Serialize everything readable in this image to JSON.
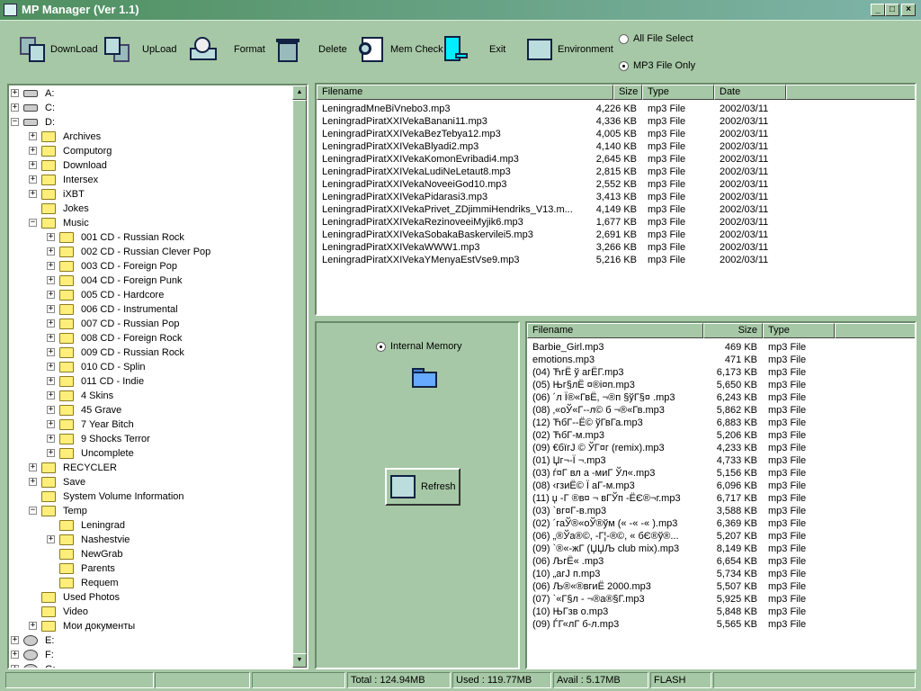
{
  "window": {
    "title": "MP Manager (Ver 1.1)",
    "minimize": "_",
    "maximize": "□",
    "close": "×"
  },
  "toolbar": {
    "buttons": [
      {
        "label": "DownLoad",
        "icon": "download-icon"
      },
      {
        "label": "UpLoad",
        "icon": "upload-icon"
      },
      {
        "label": "Format",
        "icon": "format-disk-icon"
      },
      {
        "label": "Delete",
        "icon": "trash-icon"
      },
      {
        "label": "Mem Check",
        "icon": "mem-check-icon"
      },
      {
        "label": "Exit",
        "icon": "exit-door-icon"
      },
      {
        "label": "Environment",
        "icon": "environment-icon"
      }
    ],
    "filter_all": "All File Select",
    "filter_mp3": "MP3 File Only",
    "selected_filter": "mp3"
  },
  "tree": [
    {
      "label": "A:",
      "level": 0,
      "exp": "+",
      "icon": "floppy"
    },
    {
      "label": "C:",
      "level": 0,
      "exp": "+",
      "icon": "drive"
    },
    {
      "label": "D:",
      "level": 0,
      "exp": "-",
      "icon": "drive"
    },
    {
      "label": "Archives",
      "level": 1,
      "exp": "+"
    },
    {
      "label": "Computorg",
      "level": 1,
      "exp": "+"
    },
    {
      "label": "Download",
      "level": 1,
      "exp": "+"
    },
    {
      "label": "Intersex",
      "level": 1,
      "exp": "+"
    },
    {
      "label": "iXBT",
      "level": 1,
      "exp": "+"
    },
    {
      "label": "Jokes",
      "level": 1,
      "exp": ""
    },
    {
      "label": "Music",
      "level": 1,
      "exp": "-"
    },
    {
      "label": "001 CD - Russian Rock",
      "level": 2,
      "exp": "+"
    },
    {
      "label": "002 CD - Russian Clever Pop",
      "level": 2,
      "exp": "+"
    },
    {
      "label": "003 CD - Foreign Pop",
      "level": 2,
      "exp": "+"
    },
    {
      "label": "004 CD - Foreign Punk",
      "level": 2,
      "exp": "+"
    },
    {
      "label": "005 CD - Hardcore",
      "level": 2,
      "exp": "+"
    },
    {
      "label": "006 CD - Instrumental",
      "level": 2,
      "exp": "+"
    },
    {
      "label": "007 CD - Russian Pop",
      "level": 2,
      "exp": "+"
    },
    {
      "label": "008 CD - Foreign Rock",
      "level": 2,
      "exp": "+"
    },
    {
      "label": "009 CD - Russian Rock",
      "level": 2,
      "exp": "+"
    },
    {
      "label": "010 CD - Splin",
      "level": 2,
      "exp": "+"
    },
    {
      "label": "011 CD - Indie",
      "level": 2,
      "exp": "+"
    },
    {
      "label": "4 Skins",
      "level": 2,
      "exp": "+"
    },
    {
      "label": "45 Grave",
      "level": 2,
      "exp": "+"
    },
    {
      "label": "7 Year Bitch",
      "level": 2,
      "exp": "+"
    },
    {
      "label": "9 Shocks Terror",
      "level": 2,
      "exp": "+"
    },
    {
      "label": "Uncomplete",
      "level": 2,
      "exp": "+"
    },
    {
      "label": "RECYCLER",
      "level": 1,
      "exp": "+"
    },
    {
      "label": "Save",
      "level": 1,
      "exp": "+"
    },
    {
      "label": "System Volume Information",
      "level": 1,
      "exp": ""
    },
    {
      "label": "Temp",
      "level": 1,
      "exp": "-"
    },
    {
      "label": "Leningrad",
      "level": 2,
      "exp": "",
      "icon": "folder-open"
    },
    {
      "label": "Nashestvie",
      "level": 2,
      "exp": "+"
    },
    {
      "label": "NewGrab",
      "level": 2,
      "exp": ""
    },
    {
      "label": "Parents",
      "level": 2,
      "exp": ""
    },
    {
      "label": "Requem",
      "level": 2,
      "exp": ""
    },
    {
      "label": "Used Photos",
      "level": 1,
      "exp": ""
    },
    {
      "label": "Video",
      "level": 1,
      "exp": ""
    },
    {
      "label": "Мои документы",
      "level": 1,
      "exp": "+"
    },
    {
      "label": "E:",
      "level": 0,
      "exp": "+",
      "icon": "cd"
    },
    {
      "label": "F:",
      "level": 0,
      "exp": "+",
      "icon": "cd"
    },
    {
      "label": "G:",
      "level": 0,
      "exp": "+",
      "icon": "cd"
    }
  ],
  "pc_list": {
    "headers": [
      "Filename",
      "Size",
      "Type",
      "Date"
    ],
    "rows": [
      [
        "LeningradMneBiVnebo3.mp3",
        "4,226 KB",
        "mp3 File",
        "2002/03/11"
      ],
      [
        "LeningradPiratXXIVekaBanani11.mp3",
        "4,336 KB",
        "mp3 File",
        "2002/03/11"
      ],
      [
        "LeningradPiratXXIVekaBezTebya12.mp3",
        "4,005 KB",
        "mp3 File",
        "2002/03/11"
      ],
      [
        "LeningradPiratXXIVekaBlyadi2.mp3",
        "4,140 KB",
        "mp3 File",
        "2002/03/11"
      ],
      [
        "LeningradPiratXXIVekaKomonEvribadi4.mp3",
        "2,645 KB",
        "mp3 File",
        "2002/03/11"
      ],
      [
        "LeningradPiratXXIVekaLudiNeLetaut8.mp3",
        "2,815 KB",
        "mp3 File",
        "2002/03/11"
      ],
      [
        "LeningradPiratXXIVekaNoveeiGod10.mp3",
        "2,552 KB",
        "mp3 File",
        "2002/03/11"
      ],
      [
        "LeningradPiratXXIVekaPidarasi3.mp3",
        "3,413 KB",
        "mp3 File",
        "2002/03/11"
      ],
      [
        "LeningradPiratXXIVekaPrivet_ZDjimmiHendriks_V13.m...",
        "4,149 KB",
        "mp3 File",
        "2002/03/11"
      ],
      [
        "LeningradPiratXXIVekaRezinoveeiMyjik6.mp3",
        "1,677 KB",
        "mp3 File",
        "2002/03/11"
      ],
      [
        "LeningradPiratXXIVekaSobakaBaskervilei5.mp3",
        "2,691 KB",
        "mp3 File",
        "2002/03/11"
      ],
      [
        "LeningradPiratXXIVekaWWW1.mp3",
        "3,266 KB",
        "mp3 File",
        "2002/03/11"
      ],
      [
        "LeningradPiratXXIVekaYMenyaEstVse9.mp3",
        "5,216 KB",
        "mp3 File",
        "2002/03/11"
      ]
    ]
  },
  "device": {
    "memory_label": "Internal Memory",
    "refresh": "Refresh"
  },
  "device_list": {
    "headers": [
      "Filename",
      "Size",
      "Type"
    ],
    "rows": [
      [
        "Barbie_Girl.mp3",
        "469 KB",
        "mp3 File"
      ],
      [
        "emotions.mp3",
        "471 KB",
        "mp3 File"
      ],
      [
        "(04) ЋгЁ  ў агЁГ.mp3",
        "6,173 KB",
        "mp3 File"
      ],
      [
        "(05) Њг§лЁ  ¤®і¤п.mp3",
        "5,650 KB",
        "mp3 File"
      ],
      [
        "(06) ´л Ї®«ГвЁ, ¬®п §ўГ§¤ .mp3",
        "6,243 KB",
        "mp3 File"
      ],
      [
        "(08) ‚«оЎ«Г--л© б ¬®«Гв.mp3",
        "5,862 KB",
        "mp3 File"
      ],
      [
        "(12) ЋбГ--Ё© ўГвГа.mp3",
        "6,883 KB",
        "mp3 File"
      ],
      [
        "(02) ЋбГ-м.mp3",
        "5,206 KB",
        "mp3 File"
      ],
      [
        "(09) €бїгЈ © ЎГ¤г (remix).mp3",
        "4,233 KB",
        "mp3 File"
      ],
      [
        "(01) Џг¬-Ї ¬.mp3",
        "4,733 KB",
        "mp3 File"
      ],
      [
        "(03) ѓ¤Г вл а -миГ Ўл«.mp3",
        "5,156 KB",
        "mp3 File"
      ],
      [
        "(08) ‹гзиЁ© Ї аГ-м.mp3",
        "6,096 KB",
        "mp3 File"
      ],
      [
        "(11) џ -Г ®в¤ ¬ вГЎп -ЁЄ®¬г.mp3",
        "6,717 KB",
        "mp3 File"
      ],
      [
        "(03) `вг¤Г-в.mp3",
        "3,588 KB",
        "mp3 File"
      ],
      [
        "(02) ´гаЎ®«оЎ®ўм (« -« -« ).mp3",
        "6,369 KB",
        "mp3 File"
      ],
      [
        "(06) „®Ўа®©, -Г¦-®©, « бЄ®ў®...",
        "5,207 KB",
        "mp3 File"
      ],
      [
        "(09) `®«-жГ (ЏЏЉ club mix).mp3",
        "8,149 KB",
        "mp3 File"
      ],
      [
        "(06) ЉгЁ« .mp3",
        "6,654 KB",
        "mp3 File"
      ],
      [
        "(10) „агЈ п.mp3",
        "5,734 KB",
        "mp3 File"
      ],
      [
        "(06) Љ®«®вгиЁ  2000.mp3",
        "5,507 KB",
        "mp3 File"
      ],
      [
        "(07) `«Г§л -  ¬®а®§Г.mp3",
        "5,925 KB",
        "mp3 File"
      ],
      [
        "(10) ЊГзв о.mp3",
        "5,848 KB",
        "mp3 File"
      ],
      [
        "(09) ЃГ«лГ б-л.mp3",
        "5,565 KB",
        "mp3 File"
      ]
    ]
  },
  "status": {
    "total": "Total : 124.94MB",
    "used": "Used : 119.77MB",
    "avail": "Avail :  5.17MB",
    "media": "FLASH"
  },
  "colors": {
    "background": "#a6c8a6",
    "title_gradient_start": "#4f8f5f",
    "title_gradient_end": "#7fb4a8"
  }
}
